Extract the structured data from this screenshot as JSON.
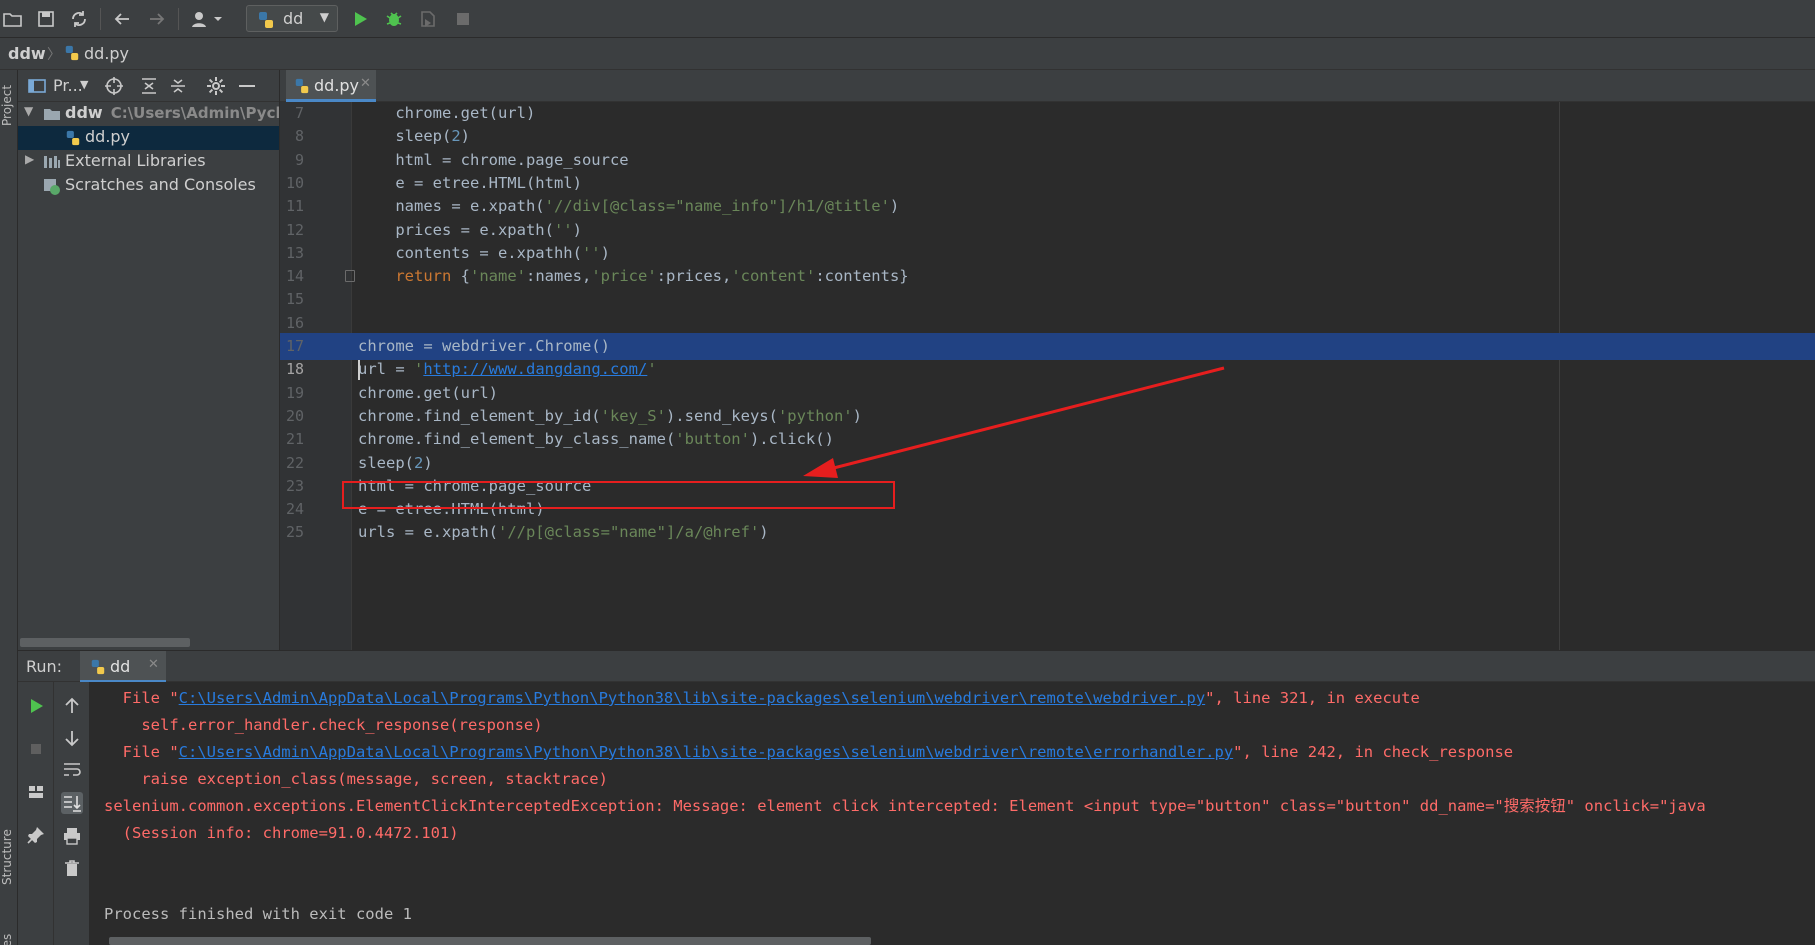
{
  "toolbar": {
    "run_config": "dd",
    "colors": {
      "run": "#4fc34f",
      "debug": "#4fc34f",
      "stop": "#6b6b6b"
    }
  },
  "breadcrumb": {
    "project": "ddw",
    "file": "dd.py"
  },
  "left_strip": {
    "project_label": "Project",
    "structure_label": "Structure",
    "favorites_label": "Favorites"
  },
  "project_panel": {
    "title": "Pr...",
    "tree": [
      {
        "label": "ddw",
        "path": "C:\\Users\\Admin\\Pych"
      },
      {
        "label": "dd.py"
      },
      {
        "label": "External Libraries"
      },
      {
        "label": "Scratches and Consoles"
      }
    ]
  },
  "editor": {
    "tab": "dd.py",
    "lines": [
      {
        "n": "7",
        "indent": "    ",
        "text": "chrome.get(url)"
      },
      {
        "n": "8",
        "indent": "    ",
        "text": "sleep(2)"
      },
      {
        "n": "9",
        "indent": "    ",
        "text": "html = chrome.page_source"
      },
      {
        "n": "10",
        "indent": "    ",
        "text": "e = etree.HTML(html)"
      },
      {
        "n": "11",
        "indent": "    ",
        "text": "names = e.xpath('//div[@class=\"name_info\"]/h1/@title')"
      },
      {
        "n": "12",
        "indent": "    ",
        "text": "prices = e.xpath('')"
      },
      {
        "n": "13",
        "indent": "    ",
        "text": "contents = e.xpathh('')"
      },
      {
        "n": "14",
        "indent": "    ",
        "text": "return {'name':names,'price':prices,'content':contents}"
      },
      {
        "n": "15",
        "indent": "",
        "text": ""
      },
      {
        "n": "16",
        "indent": "",
        "text": ""
      },
      {
        "n": "17",
        "indent": "",
        "text": "chrome = webdriver.Chrome()"
      },
      {
        "n": "18",
        "indent": "",
        "text": "url = 'http://www.dangdang.com/'"
      },
      {
        "n": "19",
        "indent": "",
        "text": "chrome.get(url)"
      },
      {
        "n": "20",
        "indent": "",
        "text": "chrome.find_element_by_id('key_S').send_keys('python')"
      },
      {
        "n": "21",
        "indent": "",
        "text": "chrome.find_element_by_class_name('button').click()"
      },
      {
        "n": "22",
        "indent": "",
        "text": "sleep(2)"
      },
      {
        "n": "23",
        "indent": "",
        "text": "html = chrome.page_source"
      },
      {
        "n": "24",
        "indent": "",
        "text": "e = etree.HTML(html)"
      },
      {
        "n": "25",
        "indent": "",
        "text": "urls = e.xpath('//p[@class=\"name\"]/a/@href')"
      }
    ],
    "selected_line": "17",
    "current_line": "18",
    "boxed_line": "21",
    "annotation_color": "#e61e1e"
  },
  "run": {
    "label": "Run:",
    "tab": "dd",
    "console": [
      {
        "kind": "err",
        "pre": "  File \"",
        "link": "C:\\Users\\Admin\\AppData\\Local\\Programs\\Python\\Python38\\lib\\site-packages\\selenium\\webdriver\\remote\\webdriver.py",
        "post": "\", line 321, in execute"
      },
      {
        "kind": "err",
        "pre": "    self.error_handler.check_response(response)"
      },
      {
        "kind": "err",
        "pre": "  File \"",
        "link": "C:\\Users\\Admin\\AppData\\Local\\Programs\\Python\\Python38\\lib\\site-packages\\selenium\\webdriver\\remote\\errorhandler.py",
        "post": "\", line 242, in check_response"
      },
      {
        "kind": "err",
        "pre": "    raise exception_class(message, screen, stacktrace)"
      },
      {
        "kind": "err",
        "pre": "selenium.common.exceptions.ElementClickInterceptedException: Message: element click intercepted: Element <input type=\"button\" class=\"button\" dd_name=\"搜索按钮\" onclick=\"java"
      },
      {
        "kind": "err",
        "pre": "  (Session info: chrome=91.0.4472.101)"
      },
      {
        "kind": "norm",
        "pre": ""
      },
      {
        "kind": "norm",
        "pre": ""
      },
      {
        "kind": "norm",
        "pre": "Process finished with exit code 1"
      }
    ]
  }
}
